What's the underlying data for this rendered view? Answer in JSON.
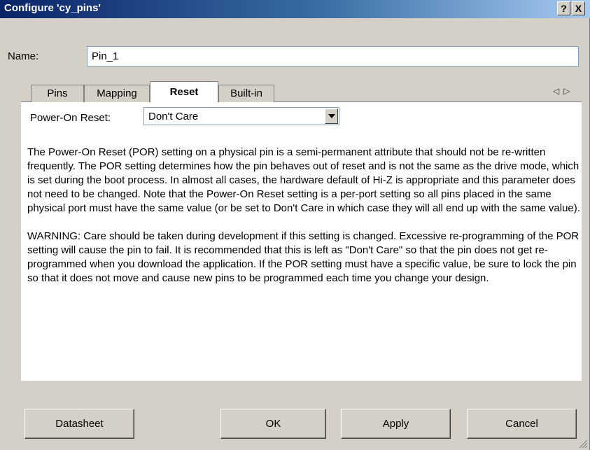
{
  "window": {
    "title": "Configure 'cy_pins'",
    "help_button": "?",
    "close_button": "X"
  },
  "name_field": {
    "label": "Name:",
    "value": "Pin_1"
  },
  "tabs": [
    {
      "label": "Pins",
      "active": false
    },
    {
      "label": "Mapping",
      "active": false
    },
    {
      "label": "Reset",
      "active": true
    },
    {
      "label": "Built-in",
      "active": false
    }
  ],
  "tab_scroll": {
    "left": "◁",
    "right": "▷"
  },
  "power_on_reset": {
    "label": "Power-On Reset:",
    "selected": "Don't Care"
  },
  "description": {
    "paragraph1": "The Power-On Reset (POR) setting on a physical pin is a semi-permanent attribute that should not be re-written frequently. The POR setting determines how the pin behaves out of reset and is not the same as the drive mode, which is set during the boot process. In almost all cases, the hardware default of Hi-Z is appropriate and this parameter does not need to be changed. Note that the Power-On Reset setting is a per-port setting so all pins placed in the same physical port must have the same value (or be set to Don't Care in which case they will all end up with the same value).",
    "paragraph2": "WARNING: Care should be taken during development if this setting is changed. Excessive re-programming of the POR setting will cause the pin to fail. It is recommended that this is left as \"Don't Care\" so that the pin does not get re-programmed when you download the application. If the POR setting must have a specific value, be sure to lock the pin so that it does not move and cause new pins to be programmed each time you change your design."
  },
  "buttons": {
    "datasheet": "Datasheet",
    "ok": "OK",
    "apply": "Apply",
    "cancel": "Cancel"
  }
}
